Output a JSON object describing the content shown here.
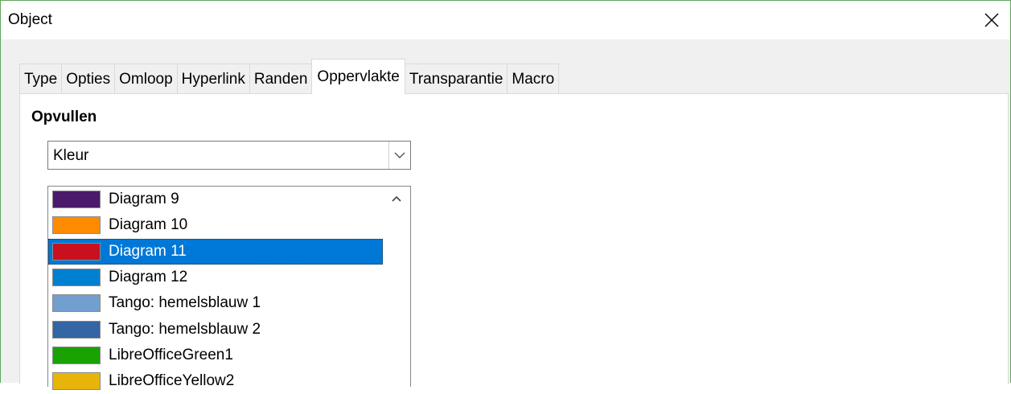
{
  "window": {
    "title": "Object"
  },
  "tabs": [
    {
      "label": "Type",
      "active": false
    },
    {
      "label": "Opties",
      "active": false
    },
    {
      "label": "Omloop",
      "active": false
    },
    {
      "label": "Hyperlink",
      "active": false
    },
    {
      "label": "Randen",
      "active": false
    },
    {
      "label": "Oppervlakte",
      "active": true
    },
    {
      "label": "Transparantie",
      "active": false
    },
    {
      "label": "Macro",
      "active": false
    }
  ],
  "fill": {
    "section_label": "Opvullen",
    "type_selected": "Kleur",
    "colors": [
      {
        "name": "Diagram 9",
        "color": "#4b1a6b",
        "selected": false
      },
      {
        "name": "Diagram 10",
        "color": "#ff8c00",
        "selected": false
      },
      {
        "name": "Diagram 11",
        "color": "#c9101e",
        "selected": true
      },
      {
        "name": "Diagram 12",
        "color": "#0080d0",
        "selected": false
      },
      {
        "name": "Tango: hemelsblauw 1",
        "color": "#729fcf",
        "selected": false
      },
      {
        "name": "Tango: hemelsblauw 2",
        "color": "#3465a4",
        "selected": false
      },
      {
        "name": "LibreOfficeGreen1",
        "color": "#18a303",
        "selected": false
      },
      {
        "name": "LibreOfficeYellow2",
        "color": "#e8b40a",
        "selected": false
      }
    ]
  }
}
